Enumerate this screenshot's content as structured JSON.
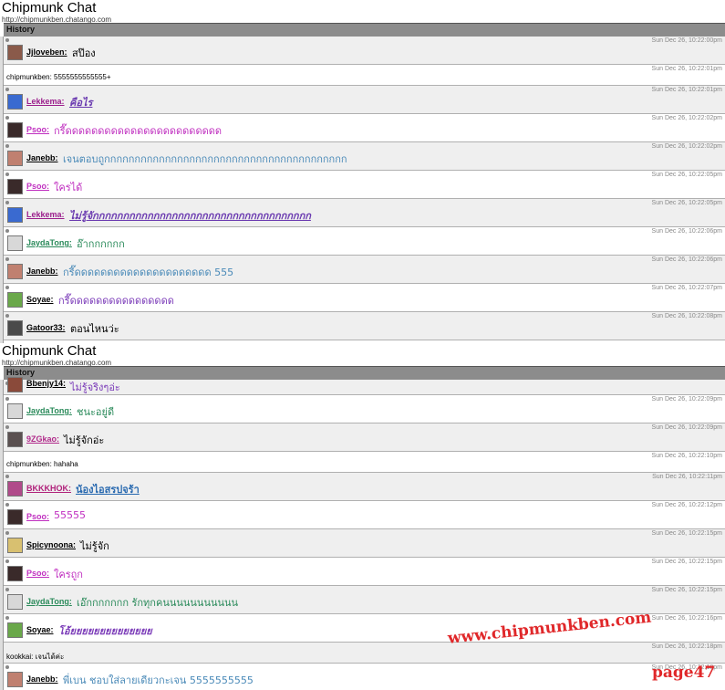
{
  "panels": [
    {
      "title": "Chipmunk Chat",
      "url": "http://chipmunkben.chatango.com",
      "history_label": "History",
      "messages": [
        {
          "user": "Jjloveben",
          "text": "สป๊อง",
          "time": "Sun Dec 26, 10:22:00pm",
          "name_color": "#000000",
          "text_color": "#000000",
          "text_style": "normal",
          "avatar": "#8a5a4a"
        },
        {
          "plain": "chipmunkben: 5555555555555+",
          "time": "Sun Dec 26, 10:22:01pm"
        },
        {
          "user": "Lekkema",
          "text": "คือไร",
          "time": "Sun Dec 26, 10:22:01pm",
          "name_color": "#9b1e8c",
          "text_color": "#6a3ab0",
          "text_style": "italic-bold-underline",
          "avatar": "#3a6ad0"
        },
        {
          "user": "Psoo",
          "text": "กรี๊ดดดดดดดดดดดดดดดดดดดดดดดด",
          "time": "Sun Dec 26, 10:22:02pm",
          "name_color": "#c030c0",
          "text_color": "#c030c0",
          "text_style": "normal",
          "avatar": "#3a2a2a"
        },
        {
          "user": "Janebb",
          "text": "เจนตอบถูกกกกกกกกกกกกกกกกกกกกกกกกกกกกกกกกกกกกกกกก",
          "time": "Sun Dec 26, 10:22:02pm",
          "name_color": "#000000",
          "text_color": "#4a8ab8",
          "text_style": "normal",
          "avatar": "#c08070"
        },
        {
          "user": "Psoo",
          "text": "ใครได้",
          "time": "Sun Dec 26, 10:22:05pm",
          "name_color": "#c030c0",
          "text_color": "#c030c0",
          "text_style": "normal",
          "avatar": "#3a2a2a"
        },
        {
          "user": "Lekkema",
          "text": "ไม่รู้จักกกกกกกกกกกกกกกกกกกกกกกกกกกกกกกกกกกก",
          "time": "Sun Dec 26, 10:22:05pm",
          "name_color": "#9b1e8c",
          "text_color": "#6a3ab0",
          "text_style": "italic-bold-underline",
          "avatar": "#3a6ad0"
        },
        {
          "user": "JaydaTong",
          "text": "อ๊ากกกกกก",
          "time": "Sun Dec 26, 10:22:06pm",
          "name_color": "#2a8a5a",
          "text_color": "#2a8a5a",
          "text_style": "normal",
          "avatar": "#d8d8d8"
        },
        {
          "user": "Janebb",
          "text": "กรี๊ดดดดดดดดดดดดดดดดดดดดด 555",
          "time": "Sun Dec 26, 10:22:06pm",
          "name_color": "#000000",
          "text_color": "#4a8ab8",
          "text_style": "normal",
          "avatar": "#c08070"
        },
        {
          "user": "Soyae",
          "text": "กรี๊ดดดดดดดดดดดดดดดด",
          "time": "Sun Dec 26, 10:22:07pm",
          "name_color": "#000000",
          "text_color": "#7a3ab8",
          "text_style": "normal",
          "avatar": "#6aa84a"
        },
        {
          "user": "Gatoor33",
          "text": "ตอนไหนว่ะ",
          "time": "Sun Dec 26, 10:22:08pm",
          "name_color": "#000000",
          "text_color": "#000000",
          "text_style": "normal",
          "avatar": "#4a4a4a"
        }
      ]
    },
    {
      "title": "Chipmunk Chat",
      "url": "http://chipmunkben.chatango.com",
      "history_label": "History",
      "messages": [
        {
          "user": "Bbenjy14",
          "text": "ไม่รู้จริงๆอ่ะ",
          "time": "",
          "name_color": "#000000",
          "text_color": "#7a3ab8",
          "text_style": "normal",
          "avatar": "#8a4a3a",
          "clipped": true
        },
        {
          "user": "JaydaTong",
          "text": "ชนะอยู่ดี",
          "time": "Sun Dec 26, 10:22:09pm",
          "name_color": "#2a8a5a",
          "text_color": "#2a8a5a",
          "text_style": "normal",
          "avatar": "#d8d8d8"
        },
        {
          "user": "9ZGkao",
          "text": "ไม่รู้จักอ่ะ",
          "time": "Sun Dec 26, 10:22:09pm",
          "name_color": "#b02a8a",
          "text_color": "#000000",
          "text_style": "normal",
          "avatar": "#5a5050"
        },
        {
          "plain": "chipmunkben: hahaha",
          "time": "Sun Dec 26, 10:22:10pm"
        },
        {
          "user": "BKKKHOK",
          "text": "น้องไอสรปจร้า",
          "time": "Sun Dec 26, 10:22:11pm",
          "name_color": "#b0207a",
          "text_color": "#2a6ab0",
          "text_style": "bold-underline",
          "avatar": "#b04a8a"
        },
        {
          "user": "Psoo",
          "text": "55555",
          "time": "Sun Dec 26, 10:22:12pm",
          "name_color": "#c030c0",
          "text_color": "#c030c0",
          "text_style": "normal",
          "avatar": "#3a2a2a"
        },
        {
          "user": "Spicynoona",
          "text": "ไม่รู้จัก",
          "time": "Sun Dec 26, 10:22:15pm",
          "name_color": "#000000",
          "text_color": "#000000",
          "text_style": "normal",
          "avatar": "#d8c070"
        },
        {
          "user": "Psoo",
          "text": "ใครถูก",
          "time": "Sun Dec 26, 10:22:15pm",
          "name_color": "#c030c0",
          "text_color": "#c030c0",
          "text_style": "normal",
          "avatar": "#3a2a2a"
        },
        {
          "user": "JaydaTong",
          "text": "เอ๊กกกกกกก รักทุกคนนนนนนนนนนน",
          "time": "Sun Dec 26, 10:22:15pm",
          "name_color": "#2a8a5a",
          "text_color": "#2a8a5a",
          "text_style": "normal",
          "avatar": "#d8d8d8"
        },
        {
          "user": "Soyae",
          "text": "โอ้ยยยยยยยยยยยยยย",
          "time": "Sun Dec 26, 10:22:16pm",
          "name_color": "#000000",
          "text_color": "#7a3ab8",
          "text_style": "italic-bold",
          "avatar": "#6aa84a"
        },
        {
          "plain": "kookkai: เจนได้ค่ะ",
          "time": "Sun Dec 26, 10:22:18pm"
        },
        {
          "user": "Janebb",
          "text": "พี่เบน ชอบใส่ลายเดียวกะเจน 5555555555",
          "time": "Sun Dec 26, 10:22:18pm",
          "name_color": "#000000",
          "text_color": "#4a8ab8",
          "text_style": "normal",
          "avatar": "#c08070"
        }
      ]
    }
  ],
  "watermark": "www.chipmunkben.com",
  "page_label": "page47"
}
